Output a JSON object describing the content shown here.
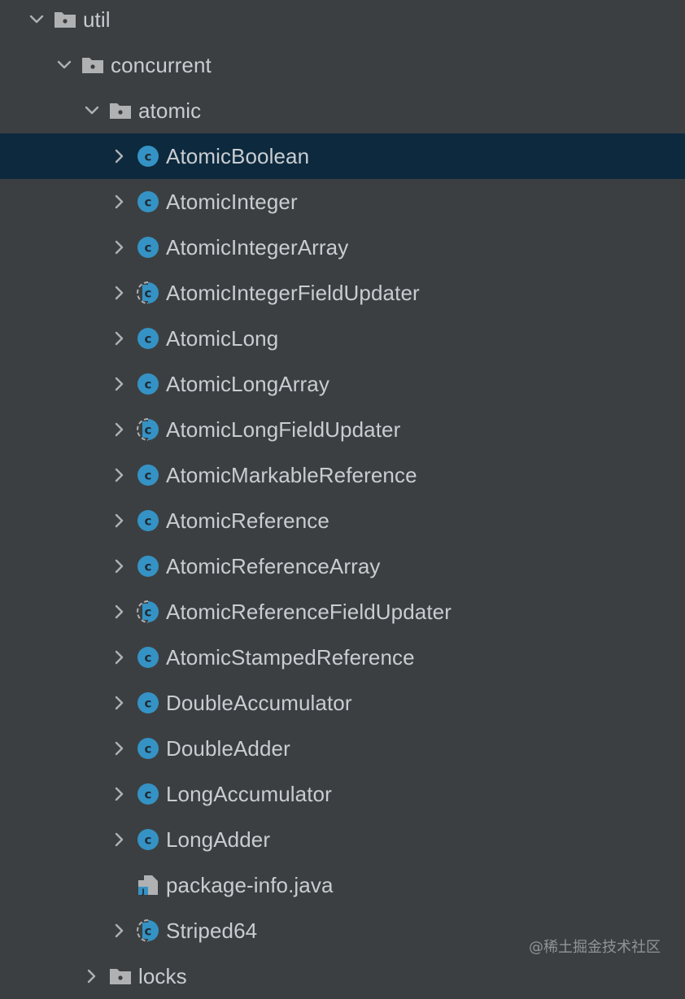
{
  "colors": {
    "background": "#3c3f41",
    "selection": "#0d293e",
    "text": "#c9cdd1",
    "class_icon": "#3592c4",
    "folder_icon": "#afb1b3"
  },
  "tree": {
    "util": {
      "label": "util",
      "icon": "folder-icon",
      "state": "expanded"
    },
    "concurrent": {
      "label": "concurrent",
      "icon": "folder-icon",
      "state": "expanded"
    },
    "atomic": {
      "label": "atomic",
      "icon": "folder-icon",
      "state": "expanded"
    },
    "items": [
      {
        "label": "AtomicBoolean",
        "icon": "class-icon",
        "selected": true
      },
      {
        "label": "AtomicInteger",
        "icon": "class-icon"
      },
      {
        "label": "AtomicIntegerArray",
        "icon": "class-icon"
      },
      {
        "label": "AtomicIntegerFieldUpdater",
        "icon": "abstract-class-icon"
      },
      {
        "label": "AtomicLong",
        "icon": "class-icon"
      },
      {
        "label": "AtomicLongArray",
        "icon": "class-icon"
      },
      {
        "label": "AtomicLongFieldUpdater",
        "icon": "abstract-class-icon"
      },
      {
        "label": "AtomicMarkableReference",
        "icon": "class-icon"
      },
      {
        "label": "AtomicReference",
        "icon": "class-icon"
      },
      {
        "label": "AtomicReferenceArray",
        "icon": "class-icon"
      },
      {
        "label": "AtomicReferenceFieldUpdater",
        "icon": "abstract-class-icon"
      },
      {
        "label": "AtomicStampedReference",
        "icon": "class-icon"
      },
      {
        "label": "DoubleAccumulator",
        "icon": "class-icon"
      },
      {
        "label": "DoubleAdder",
        "icon": "class-icon"
      },
      {
        "label": "LongAccumulator",
        "icon": "class-icon"
      },
      {
        "label": "LongAdder",
        "icon": "class-icon"
      },
      {
        "label": "package-info.java",
        "icon": "java-file-icon"
      },
      {
        "label": "Striped64",
        "icon": "abstract-class-icon"
      }
    ],
    "locks": {
      "label": "locks",
      "icon": "folder-icon",
      "state": "collapsed"
    }
  },
  "watermark": "@稀土掘金技术社区"
}
